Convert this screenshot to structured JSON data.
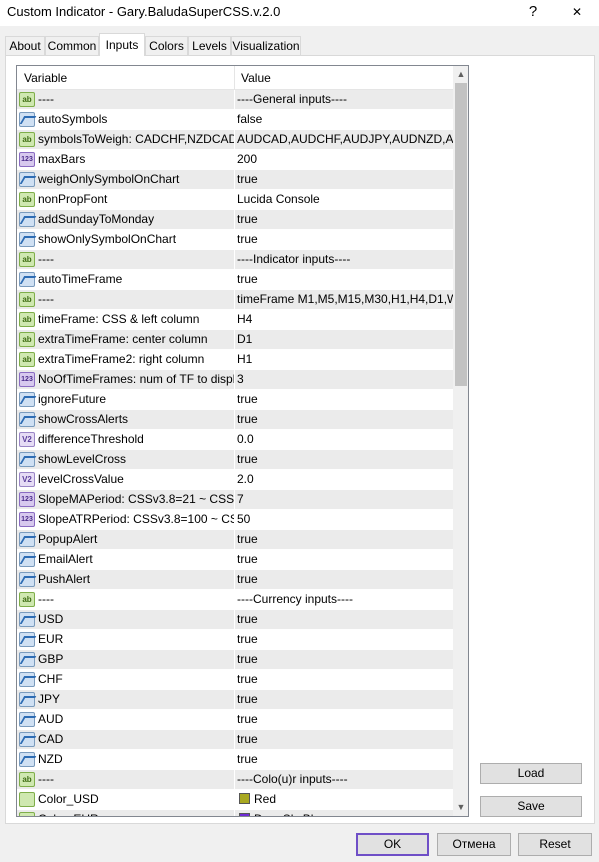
{
  "window": {
    "title": "Custom Indicator - Gary.BaludaSuperCSS.v.2.0",
    "help_label": "?",
    "close_label": "✕"
  },
  "tabs": [
    {
      "label": "About"
    },
    {
      "label": "Common"
    },
    {
      "label": "Inputs",
      "active": true
    },
    {
      "label": "Colors"
    },
    {
      "label": "Levels"
    },
    {
      "label": "Visualization"
    }
  ],
  "grid": {
    "headers": {
      "variable": "Variable",
      "value": "Value"
    },
    "rows": [
      {
        "icon": "ab",
        "variable": "----",
        "value": "----General inputs----"
      },
      {
        "icon": "bool",
        "variable": "autoSymbols",
        "value": "false"
      },
      {
        "icon": "ab",
        "variable": "symbolsToWeigh: CADCHF,NZDCAD,...",
        "value": "AUDCAD,AUDCHF,AUDJPY,AUDNZD,A..."
      },
      {
        "icon": "int",
        "variable": "maxBars",
        "value": "200"
      },
      {
        "icon": "bool",
        "variable": "weighOnlySymbolOnChart",
        "value": "true"
      },
      {
        "icon": "ab",
        "variable": "nonPropFont",
        "value": "Lucida Console"
      },
      {
        "icon": "bool",
        "variable": "addSundayToMonday",
        "value": "true"
      },
      {
        "icon": "bool",
        "variable": "showOnlySymbolOnChart",
        "value": "true"
      },
      {
        "icon": "ab",
        "variable": "----",
        "value": "----Indicator inputs----"
      },
      {
        "icon": "bool",
        "variable": "autoTimeFrame",
        "value": "true"
      },
      {
        "icon": "ab",
        "variable": "----",
        "value": "timeFrame M1,M5,M15,M30,H1,H4,D1,W..."
      },
      {
        "icon": "ab",
        "variable": "timeFrame: CSS & left column",
        "value": "H4"
      },
      {
        "icon": "ab",
        "variable": "extraTimeFrame: center column",
        "value": "D1"
      },
      {
        "icon": "ab",
        "variable": "extraTimeFrame2: right column",
        "value": "H1"
      },
      {
        "icon": "int",
        "variable": "NoOfTimeFrames: num of TF to display",
        "value": "3"
      },
      {
        "icon": "bool",
        "variable": "ignoreFuture",
        "value": "true"
      },
      {
        "icon": "bool",
        "variable": "showCrossAlerts",
        "value": "true"
      },
      {
        "icon": "dbl",
        "variable": "differenceThreshold",
        "value": "0.0"
      },
      {
        "icon": "bool",
        "variable": "showLevelCross",
        "value": "true"
      },
      {
        "icon": "dbl",
        "variable": "levelCrossValue",
        "value": "2.0"
      },
      {
        "icon": "int",
        "variable": "SlopeMAPeriod: CSSv3.8=21 ~ CSSS...",
        "value": "7"
      },
      {
        "icon": "int",
        "variable": "SlopeATRPeriod: CSSv3.8=100 ~ CS...",
        "value": "50"
      },
      {
        "icon": "bool",
        "variable": "PopupAlert",
        "value": "true"
      },
      {
        "icon": "bool",
        "variable": "EmailAlert",
        "value": "true"
      },
      {
        "icon": "bool",
        "variable": "PushAlert",
        "value": "true"
      },
      {
        "icon": "ab",
        "variable": "----",
        "value": "----Currency inputs----"
      },
      {
        "icon": "bool",
        "variable": "USD",
        "value": "true"
      },
      {
        "icon": "bool",
        "variable": "EUR",
        "value": "true"
      },
      {
        "icon": "bool",
        "variable": "GBP",
        "value": "true"
      },
      {
        "icon": "bool",
        "variable": "CHF",
        "value": "true"
      },
      {
        "icon": "bool",
        "variable": "JPY",
        "value": "true"
      },
      {
        "icon": "bool",
        "variable": "AUD",
        "value": "true"
      },
      {
        "icon": "bool",
        "variable": "CAD",
        "value": "true"
      },
      {
        "icon": "bool",
        "variable": "NZD",
        "value": "true"
      },
      {
        "icon": "ab",
        "variable": "----",
        "value": "----Colo(u)r inputs----"
      },
      {
        "icon": "color",
        "variable": "Color_USD",
        "value": "Red",
        "swatch": "#a8a820"
      },
      {
        "icon": "color",
        "variable": "Color_EUR",
        "value": "DeepSkyBlue",
        "swatch": "#6f2bd6"
      }
    ]
  },
  "buttons": {
    "load": "Load",
    "save": "Save",
    "ok": "OK",
    "cancel": "Отмена",
    "reset": "Reset"
  },
  "scrollbar": {
    "up": "▲",
    "down": "▼"
  }
}
